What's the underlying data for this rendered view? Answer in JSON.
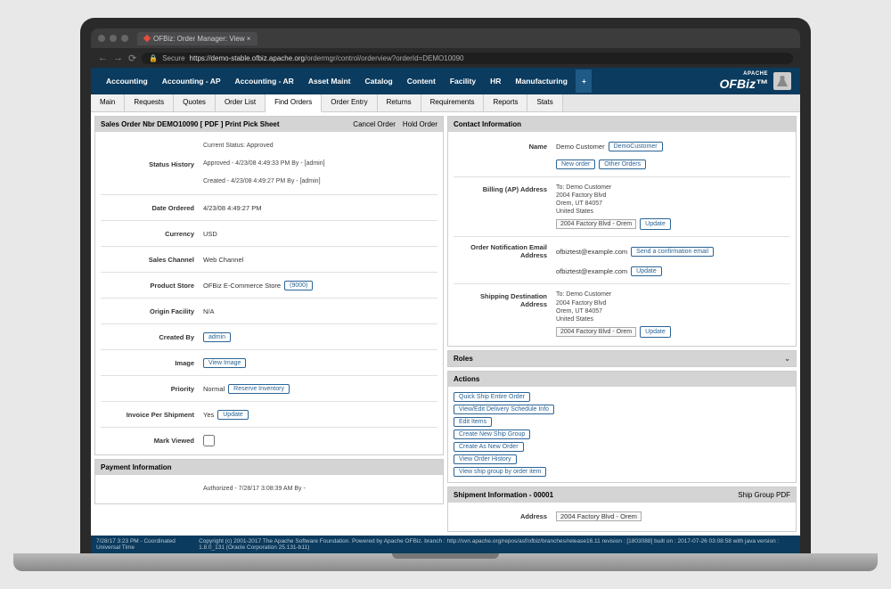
{
  "browser": {
    "tab_title": "OFBiz: Order Manager: View ×",
    "secure_label": "Secure",
    "url_domain": "https://demo-stable.ofbiz.apache.org",
    "url_path": "/ordermgr/control/orderview?orderId=DEMO10090"
  },
  "top_nav": [
    "Accounting",
    "Accounting - AP",
    "Accounting - AR",
    "Asset Maint",
    "Catalog",
    "Content",
    "Facility",
    "HR",
    "Manufacturing"
  ],
  "logo": {
    "apache": "APACHE",
    "name": "OFBiz"
  },
  "sub_nav": [
    "Main",
    "Requests",
    "Quotes",
    "Order List",
    "Find Orders",
    "Order Entry",
    "Returns",
    "Requirements",
    "Reports",
    "Stats"
  ],
  "sub_nav_active": "Find Orders",
  "order_panel": {
    "title": "Sales Order Nbr DEMO10090 [ PDF ]   Print Pick Sheet",
    "action_cancel": "Cancel Order",
    "action_hold": "Hold Order",
    "rows": {
      "current_status": "Current Status: Approved",
      "status_history_label": "Status History",
      "status_history_1": "Approved - 4/23/08 4:49:33 PM   By - [admin]",
      "status_history_2": "Created - 4/23/08 4:49:27 PM   By - [admin]",
      "date_ordered_label": "Date Ordered",
      "date_ordered": "4/23/08 4:49:27 PM",
      "currency_label": "Currency",
      "currency": "USD",
      "sales_channel_label": "Sales Channel",
      "sales_channel": "Web Channel",
      "product_store_label": "Product Store",
      "product_store": "OFBiz E-Commerce Store",
      "product_store_id": "(9000)",
      "origin_facility_label": "Origin Facility",
      "origin_facility": "N/A",
      "created_by_label": "Created By",
      "created_by": "admin",
      "image_label": "Image",
      "image_btn": "View Image",
      "priority_label": "Priority",
      "priority_value": "Normal",
      "priority_btn": "Reserve Inventory",
      "invoice_label": "Invoice Per Shipment",
      "invoice_value": "Yes",
      "invoice_btn": "Update",
      "mark_viewed_label": "Mark Viewed"
    }
  },
  "payment_panel": {
    "title": "Payment Information",
    "text": "Authorized - 7/28/17 3:08:39 AM   By -"
  },
  "contact_panel": {
    "title": "Contact Information",
    "name_label": "Name",
    "customer": "Demo Customer",
    "customer_btn": "DemoCustomer",
    "new_order_btn": "New order",
    "other_orders_btn": "Other Orders",
    "billing_label": "Billing (AP) Address",
    "billing_to": "To: Demo Customer",
    "billing_addr1": "2004 Factory Blvd",
    "billing_addr2": "Orem, UT 84057",
    "billing_country": "United States",
    "billing_select": "2004 Factory Blvd - Orem",
    "update_btn": "Update",
    "email_label": "Order Notification Email Address",
    "email1": "ofbiztest@example.com",
    "email1_btn": "Send a confirmation email",
    "email2": "ofbiztest@example.com",
    "shipping_label": "Shipping Destination Address",
    "shipping_to": "To: Demo Customer",
    "shipping_addr1": "2004 Factory Blvd",
    "shipping_addr2": "Orem, UT 84057",
    "shipping_country": "United States",
    "shipping_select": "2004 Factory Blvd - Orem"
  },
  "roles_panel": {
    "title": "Roles"
  },
  "actions_panel": {
    "title": "Actions",
    "items": [
      "Quick Ship Entire Order",
      "View/Edit Delivery Schedule Info",
      "Edit Items",
      "Create New Ship Group",
      "Create As New Order",
      "View Order History",
      "View ship group by order item"
    ]
  },
  "shipment_panel": {
    "title": "Shipment Information - 00001",
    "action_pdf": "Ship Group PDF",
    "address_label": "Address",
    "address_value": "2004 Factory Blvd - Orem"
  },
  "footer": {
    "left": "7/28/17 3:23 PM - Coordinated Universal Time",
    "right": "Copyright (c) 2001-2017 The Apache Software Foundation. Powered by Apache OFBiz. branch : http://svn.apache.org/repos/asf/ofbiz/branches/release16.11 revision : [1803088] built on : 2017-07-26 03:08:58 with java version : 1.8.0_131 (Oracle Corporation 25.131-b11)"
  }
}
